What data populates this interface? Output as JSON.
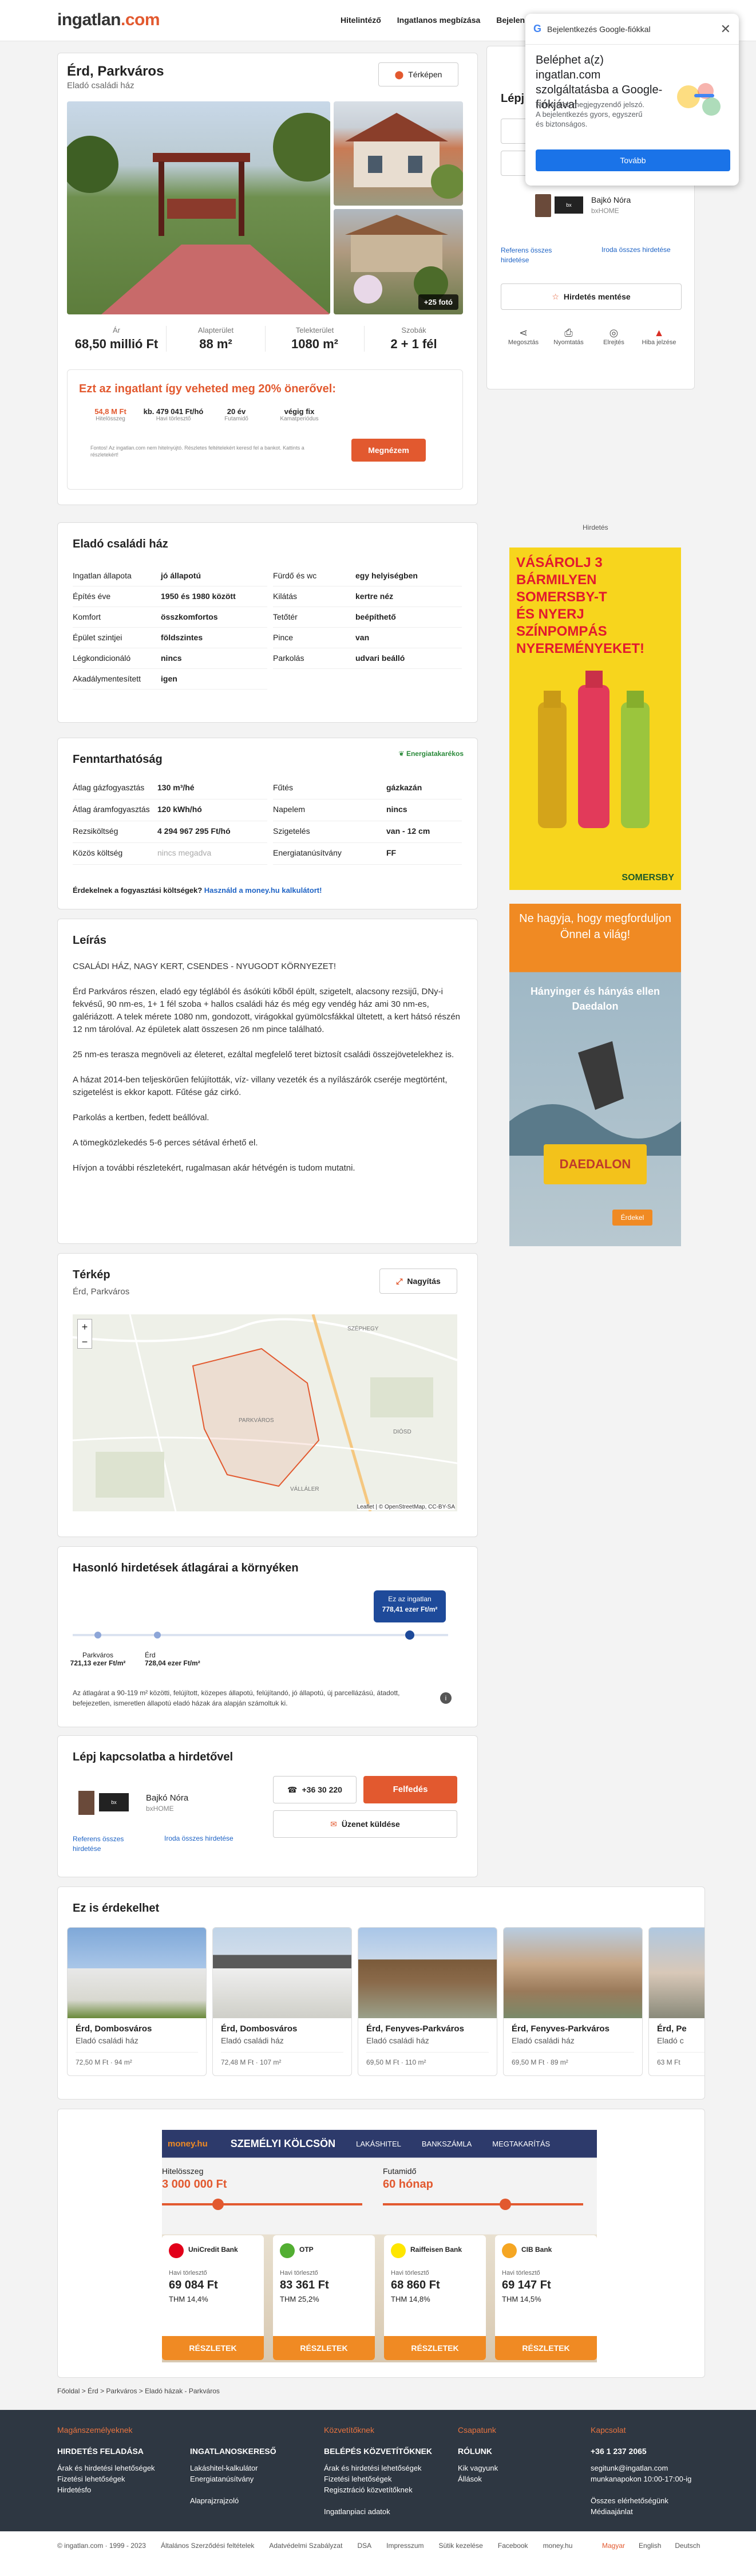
{
  "header": {
    "logo_main": "ingatlan",
    "logo_dot": ".com",
    "nav": [
      "Hitelintéző",
      "Ingatlanos megbízása",
      "Bejelen"
    ]
  },
  "google_popup": {
    "title": "Bejelentkezés Google-fiókkal",
    "heading": "Beléphet a(z) ingatlan.com szolgáltatásba a Google-fiókjával",
    "text": "Nincs több megjegyzendő jelszó. A bejelentkezés gyors, egyszerű és biztonságos.",
    "button": "Tovább"
  },
  "listing": {
    "title": "Érd, Parkváros",
    "subtitle": "Eladó családi ház",
    "map_button": "Térképen",
    "photo_count": "+25 fotó",
    "stats": [
      {
        "label": "Ár",
        "value": "68,50 millió Ft"
      },
      {
        "label": "Alapterület",
        "value": "88 m²"
      },
      {
        "label": "Telekterület",
        "value": "1080 m²"
      },
      {
        "label": "Szobák",
        "value": "2 + 1 fél"
      }
    ],
    "loan_title": "Ezt az ingatlant így veheted meg 20% önerővel:",
    "loan": [
      {
        "v": "54,8 M Ft",
        "l": "Hitelösszeg"
      },
      {
        "v": "kb. 479 041 Ft/hó",
        "l": "Havi törlesztő"
      },
      {
        "v": "20 év",
        "l": "Futamidő"
      },
      {
        "v": "végig fix",
        "l": "Kamatperiódus"
      }
    ],
    "loan_note": "Fontos! Az ingatlan.com nem hitelnyújtó. Részletes feltételekért keresd fel a bankot. Kattints a részletekért!",
    "loan_button": "Megnézem"
  },
  "contact_side": {
    "title": "Lépj",
    "agent_name": "Bajkó Nóra",
    "agent_company": "bxHOME",
    "ref_link": "Referens összes hirdetése",
    "office_link": "Iroda összes hirdetése",
    "save_button": "Hirdetés mentése",
    "actions": [
      "Megosztás",
      "Nyomtatás",
      "Elrejtés",
      "Hiba jelzése"
    ]
  },
  "ad_label": "Hirdetés",
  "ad1": {
    "line1": "VÁSÁROLJ 3 BÁRMILYEN",
    "line2": "SOMERSBY-T",
    "line3": "ÉS NYERJ",
    "line4": "SZÍNPOMPÁS",
    "line5": "NYEREMÉNYEKET!",
    "brand": "SOMERSBY"
  },
  "ad2": {
    "line1": "Ne hagyja, hogy megforduljon",
    "line2": "Önnel a világ!",
    "line3": "Hányinger és hányás ellen",
    "line4": "Daedalon",
    "product": "DAEDALON",
    "cta": "Érdekel"
  },
  "details": {
    "title": "Eladó családi ház",
    "left": [
      [
        "Ingatlan állapota",
        "jó állapotú"
      ],
      [
        "Építés éve",
        "1950 és 1980 között"
      ],
      [
        "Komfort",
        "összkomfortos"
      ],
      [
        "Épület szintjei",
        "földszintes"
      ],
      [
        "Légkondicionáló",
        "nincs"
      ],
      [
        "Akadálymentesített",
        "igen"
      ]
    ],
    "right": [
      [
        "Fürdő és wc",
        "egy helyiségben"
      ],
      [
        "Kilátás",
        "kertre néz"
      ],
      [
        "Tetőtér",
        "beépíthető"
      ],
      [
        "Pince",
        "van"
      ],
      [
        "Parkolás",
        "udvari beálló"
      ]
    ]
  },
  "energy": {
    "title": "Fenntarthatóság",
    "badge": "Energiatakarékos",
    "left": [
      [
        "Átlag gázfogyasztás",
        "130 m³/hé"
      ],
      [
        "Átlag áramfogyasztás",
        "120 kWh/hó"
      ],
      [
        "Rezsiköltség",
        "4 294 967 295 Ft/hó"
      ],
      [
        "Közös költség",
        "nincs megadva"
      ]
    ],
    "right": [
      [
        "Fűtés",
        "gázkazán"
      ],
      [
        "Napelem",
        "nincs"
      ],
      [
        "Szigetelés",
        "van - 12 cm"
      ],
      [
        "Energiatanúsítvány",
        "FF"
      ]
    ],
    "calc_text": "Érdekelnek a fogyasztási költségek?",
    "calc_link": "Használd a money.hu kalkulátort!"
  },
  "description": {
    "title": "Leírás",
    "paragraphs": [
      "CSALÁDI HÁZ, NAGY KERT, CSENDES - NYUGODT KÖRNYEZET!",
      "Érd Parkváros részen, eladó egy téglából és ásókúti kőből épült, szigetelt, alacsony rezsijű, DNy-i fekvésű, 90 nm-es, 1+ 1 fél szoba + hallos családi ház és még egy vendég ház ami 30 nm-es, galériázott. A telek mérete 1080 nm, gondozott, virágokkal gyümölcsfákkal ültetett, a kert hátsó részén 12 nm tárolóval. Az épületek alatt összesen 26 nm pince található.",
      "25 nm-es terasza megnöveli az életeret, ezáltal megfelelő teret biztosít családi összejövetelekhez is.",
      "A házat 2014-ben teljeskörűen felújították, víz- villany vezeték és a nyílászárók cseréje megtörtént, szigetelést is ekkor kapott. Fűtése gáz cirkó.",
      "Parkolás a kertben, fedett beállóval.",
      "A tömegközlekedés 5-6 perces sétával érhető el.",
      "Hívjon a további részletekért, rugalmasan akár hétvégén is tudom mutatni."
    ]
  },
  "map": {
    "title": "Térkép",
    "subtitle": "Érd, Parkváros",
    "zoom_button": "Nagyítás",
    "attrib": "Leaflet | © OpenStreetMap, CC-BY-SA",
    "labels": [
      "PARKVÁROS",
      "DIÓSD",
      "VÁLLÁLER",
      "SZÉPHEGY"
    ]
  },
  "price_compare": {
    "title": "Hasonló hirdetések átlagárai a környéken",
    "bubble_line1": "Ez az ingatlan",
    "bubble_line2": "778,41 ezer Ft/m²",
    "p1_label": "Parkváros",
    "p1_value": "721,13 ezer Ft/m²",
    "p2_label": "Érd",
    "p2_value": "728,04 ezer Ft/m²",
    "note": "Az átlagárat a 90-119 m² közötti, felújított, közepes állapotú, felújítandó, jó állapotú, új parcellázású, átadott, befejezetlen, ismeretlen állapotú eladó házak ára alapján számoltuk ki."
  },
  "contact_main": {
    "title": "Lépj kapcsolatba a hirdetővel",
    "agent_name": "Bajkó Nóra",
    "agent_company": "bxHOME",
    "ref_link": "Referens összes hirdetése",
    "office_link": "Iroda összes hirdetése",
    "phone": "+36 30 220",
    "reveal": "Felfedés",
    "message": "Üzenet küldése"
  },
  "similar": {
    "title": "Ez is érdekelhet",
    "items": [
      {
        "t": "Érd, Dombosváros",
        "s": "Eladó családi ház",
        "m": "72,50 M Ft  ·  94 m²"
      },
      {
        "t": "Érd, Dombosváros",
        "s": "Eladó családi ház",
        "m": "72,48 M Ft  ·  107 m²"
      },
      {
        "t": "Érd, Fenyves-Parkváros",
        "s": "Eladó családi ház",
        "m": "69,50 M Ft  ·  110 m²"
      },
      {
        "t": "Érd, Fenyves-Parkváros",
        "s": "Eladó családi ház",
        "m": "69,50 M Ft  ·  89 m²"
      },
      {
        "t": "Érd, Pe",
        "s": "Eladó c",
        "m": "63 M Ft"
      }
    ]
  },
  "money": {
    "brand": "money.hu",
    "headline": "SZEMÉLYI KÖLCSÖN",
    "tabs": [
      "LAKÁSHITEL",
      "BANKSZÁMLA",
      "MEGTAKARÍTÁS"
    ],
    "amount_label": "Hitelösszeg",
    "amount_value": "3 000 000 Ft",
    "term_label": "Futamidő",
    "term_value": "60 hónap",
    "banks": [
      {
        "name": "UniCredit Bank",
        "monthly": "69 084 Ft",
        "thm": "THM 14,4%",
        "cta": "RÉSZLETEK",
        "color": "#e2001a"
      },
      {
        "name": "OTP",
        "monthly": "83 361 Ft",
        "thm": "THM 25,2%",
        "cta": "RÉSZLETEK",
        "color": "#52ae32"
      },
      {
        "name": "Raiffeisen Bank",
        "monthly": "68 860 Ft",
        "thm": "THM 14,8%",
        "cta": "RÉSZLETEK",
        "color": "#fee600"
      },
      {
        "name": "CIB Bank",
        "monthly": "69 147 Ft",
        "thm": "THM 14,5%",
        "cta": "RÉSZLETEK",
        "color": "#f5a623"
      }
    ],
    "monthly_label": "Havi törlesztő"
  },
  "breadcrumb": [
    "Főoldal",
    "Érd",
    "Parkváros",
    "Eladó házak - Parkváros"
  ],
  "footer": {
    "cols": [
      {
        "head": "Magánszemélyeknek",
        "title": "HIRDETÉS FELADÁSA",
        "links": [
          "Árak és hirdetési lehetőségek",
          "Fizetési lehetőségek",
          "Hirdetésfo"
        ]
      },
      {
        "head": "",
        "title": "INGATLANOSKERESŐ",
        "links": [
          "Lakáshitel-kalkulátor",
          "Energiatanúsítvány",
          "",
          "Alaprajzrajzoló"
        ]
      },
      {
        "head": "Közvetítőknek",
        "title": "BELÉPÉS KÖZVETÍTŐKNEK",
        "links": [
          "Árak és hirdetési lehetőségek",
          "Fizetési lehetőségek",
          "Regisztráció közvetítőknek",
          "",
          "Ingatlanpiaci adatok"
        ]
      },
      {
        "head": "Csapatunk",
        "title": "RÓLUNK",
        "links": [
          "Kik vagyunk",
          "Állások"
        ]
      },
      {
        "head": "Kapcsolat",
        "title": "+36 1 237 2065",
        "links": [
          "segitunk@ingatlan.com",
          "munkanapokon 10:00-17:00-ig",
          "",
          "Összes elérhetőségünk",
          "Médiaajánlat"
        ]
      }
    ],
    "bottom": [
      "© ingatlan.com · 1999 - 2023",
      "Általános Szerződési feltételek",
      "Adatvédelmi Szabályzat",
      "DSA",
      "Impresszum",
      "Sütik kezelése",
      "Facebook",
      "money.hu"
    ],
    "langs": [
      "Magyar",
      "English",
      "Deutsch"
    ]
  }
}
